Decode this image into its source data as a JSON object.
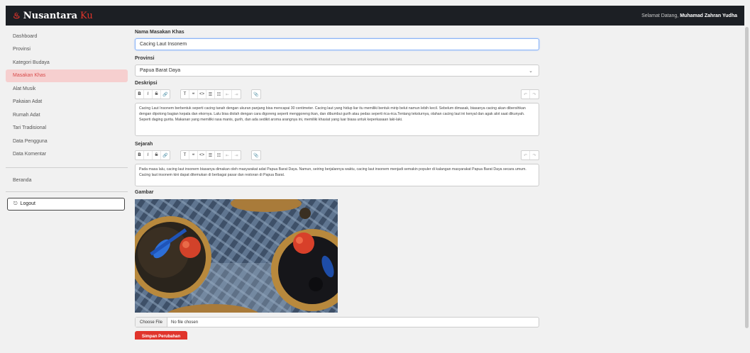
{
  "header": {
    "brand_main": "Nusantara",
    "brand_accent": "Ku",
    "greeting": "Selamat Datang,",
    "user_name": "Muhamad Zahran Yudha"
  },
  "sidebar": {
    "items": [
      {
        "label": "Dashboard"
      },
      {
        "label": "Provinsi"
      },
      {
        "label": "Kategori Budaya"
      },
      {
        "label": "Masakan Khas",
        "active": true
      },
      {
        "label": "Alat Musik"
      },
      {
        "label": "Pakaian Adat"
      },
      {
        "label": "Rumah Adat"
      },
      {
        "label": "Tari Tradisional"
      },
      {
        "label": "Data Pengguna"
      },
      {
        "label": "Data Komentar"
      }
    ],
    "beranda": "Beranda",
    "logout": "Logout"
  },
  "form": {
    "nama_label": "Nama Masakan Khas",
    "nama_value": "Cacing Laut Insonem",
    "provinsi_label": "Provinsi",
    "provinsi_value": "Papua Barat Daya",
    "deskripsi_label": "Deskripsi",
    "deskripsi_text": "Cacing Laut Insonem berbentuk seperti cacing tanah dengan ukuran panjang bisa mencapai 30 centimeter. Cacing laut yang hidup liar itu memiliki bentuk mirip belut namun lebih kecil. Sebelum dimasak, biasanya cacing akan dibersihkan dengan dipotong bagian kepala dan ekornya. Lalu bisa diolah dengan cara digoreng seperti menggoreng ikan, dan dibumbui gurih atau pedas seperti rica-rica.Tentang teksturnya, olahan cacing laut ini kenyal dan agak alot saat dikunyah. Seperti daging gurita. Makanan yang memiliki rasa manis, gurih, dan ada sedikit aroma arangnya ini, memiliki khasiat yang luar biasa untuk keperkasaan laki-laki.",
    "sejarah_label": "Sejarah",
    "sejarah_text": "Pada masa lalu, cacing laut insonem biasanya dimakan oleh masyarakat adat Papua Barat Daya. Namun, seiring berjalannya waktu, cacing laut insonem menjadi semakin populer di kalangan masyarakat Papua Barat Daya secara umum. Cacing laut insonem kini dapat ditemukan di berbagai pasar dan restoran di Papua Barat.",
    "gambar_label": "Gambar",
    "choose_file": "Choose File",
    "no_file": "No file chosen",
    "save_label": "Simpan Perubahan"
  },
  "toolbar": {
    "bold": "B",
    "italic": "I",
    "strike": "S",
    "link": "🔗",
    "heading": "T",
    "quote": "❝",
    "code": "<>",
    "bullet_list": "☰",
    "number_list": "☷",
    "indent_dec": "⇤",
    "indent_inc": "⇥",
    "attach": "📎",
    "undo": "↶",
    "redo": "↷"
  },
  "colors": {
    "accent": "#e0342b",
    "topbar": "#1c1f24",
    "active_bg": "#f6cfcf"
  }
}
